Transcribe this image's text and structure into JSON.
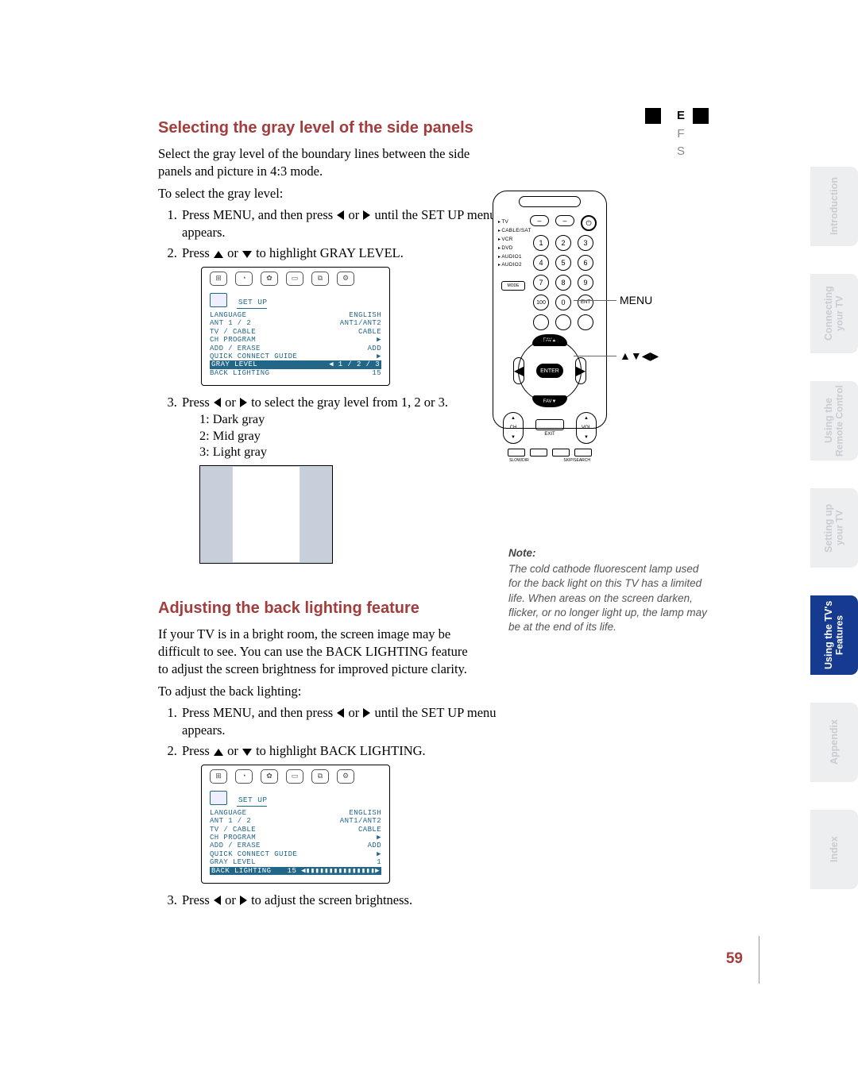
{
  "efs": {
    "e": "E",
    "f": "F",
    "s": "S"
  },
  "section1": {
    "heading": "Selecting the gray level of the side panels",
    "intro": "Select the gray level of the boundary lines between the side panels and picture in 4:3 mode.",
    "lead": "To select the gray level:",
    "step1": "Press MENU, and then press",
    "step1b": "until the SET UP menu appears.",
    "or1": "or",
    "step2": "Press",
    "step2b": "to highlight GRAY LEVEL.",
    "or2": "or",
    "step3": "Press",
    "step3b": "to select the gray level from 1, 2 or 3.",
    "or3": "or",
    "g1": "1: Dark gray",
    "g2": "2: Mid gray",
    "g3": "3: Light gray"
  },
  "osd_header_label": "SET  UP",
  "osd1": {
    "rows": [
      {
        "l": "LANGUAGE",
        "r": "ENGLISH"
      },
      {
        "l": "ANT 1 / 2",
        "r": "ANT1/ANT2"
      },
      {
        "l": "TV / CABLE",
        "r": "CABLE"
      },
      {
        "l": "CH  PROGRAM",
        "r": "▶"
      },
      {
        "l": "ADD / ERASE",
        "r": "ADD"
      },
      {
        "l": "QUICK CONNECT GUIDE",
        "r": "▶"
      }
    ],
    "hi": {
      "l": "GRAY  LEVEL",
      "r": "◀ 1 / 2 / 3"
    },
    "last": {
      "l": "BACK  LIGHTING",
      "r": "15"
    }
  },
  "section2": {
    "heading": "Adjusting the back lighting feature",
    "intro": "If your TV is in a bright room, the screen image may be difficult to see. You can use the BACK LIGHTING feature to adjust the screen brightness for improved picture clarity.",
    "lead": "To adjust the back lighting:",
    "step1": "Press MENU, and then press",
    "step1b": "until the SET UP menu appears.",
    "or1": "or",
    "step2": "Press",
    "step2b": "to highlight BACK LIGHTING.",
    "or2": "or",
    "step3": "Press",
    "step3b": "to adjust the screen brightness.",
    "or3": "or"
  },
  "osd2": {
    "rows": [
      {
        "l": "LANGUAGE",
        "r": "ENGLISH"
      },
      {
        "l": "ANT 1 / 2",
        "r": "ANT1/ANT2"
      },
      {
        "l": "TV / CABLE",
        "r": "CABLE"
      },
      {
        "l": "CH  PROGRAM",
        "r": "▶"
      },
      {
        "l": "ADD / ERASE",
        "r": "ADD"
      },
      {
        "l": "QUICK CONNECT GUIDE",
        "r": "▶"
      },
      {
        "l": "GRAY  LEVEL",
        "r": "1"
      }
    ],
    "hi": {
      "l": "BACK  LIGHTING",
      "r": "15 ◀▮▮▮▮▮▮▮▮▮▮▮▮▮▮▮▶"
    }
  },
  "note": {
    "head": "Note:",
    "body": "The cold cathode fluorescent lamp used for the back light on this TV has a limited life. When areas on the screen darken, flicker, or no longer light up, the lamp may be at the end of its life."
  },
  "remote": {
    "menu_label": "MENU",
    "arrows_label": "▲▼◀▶",
    "power": "POWER",
    "side": [
      "TV",
      "CABLE/SAT",
      "VCR",
      "DVD",
      "AUDIO1",
      "AUDIO2"
    ],
    "mode": "MODE",
    "enter": "ENTER",
    "favA": "FAV▲",
    "favB": "FAV▼",
    "ch": "CH",
    "vol": "VOL",
    "exit": "EXIT",
    "sub1": "SLOW/DIR",
    "sub2": "SKIP/SEARCH"
  },
  "tabs": {
    "t1": "Introduction",
    "t2a": "Connecting",
    "t2b": "your TV",
    "t3a": "Using the",
    "t3b": "Remote Control",
    "t4a": "Setting up",
    "t4b": "your TV",
    "t5a": "Using the TV's",
    "t5b": "Features",
    "t6": "Appendix",
    "t7": "Index"
  },
  "page_number": "59"
}
